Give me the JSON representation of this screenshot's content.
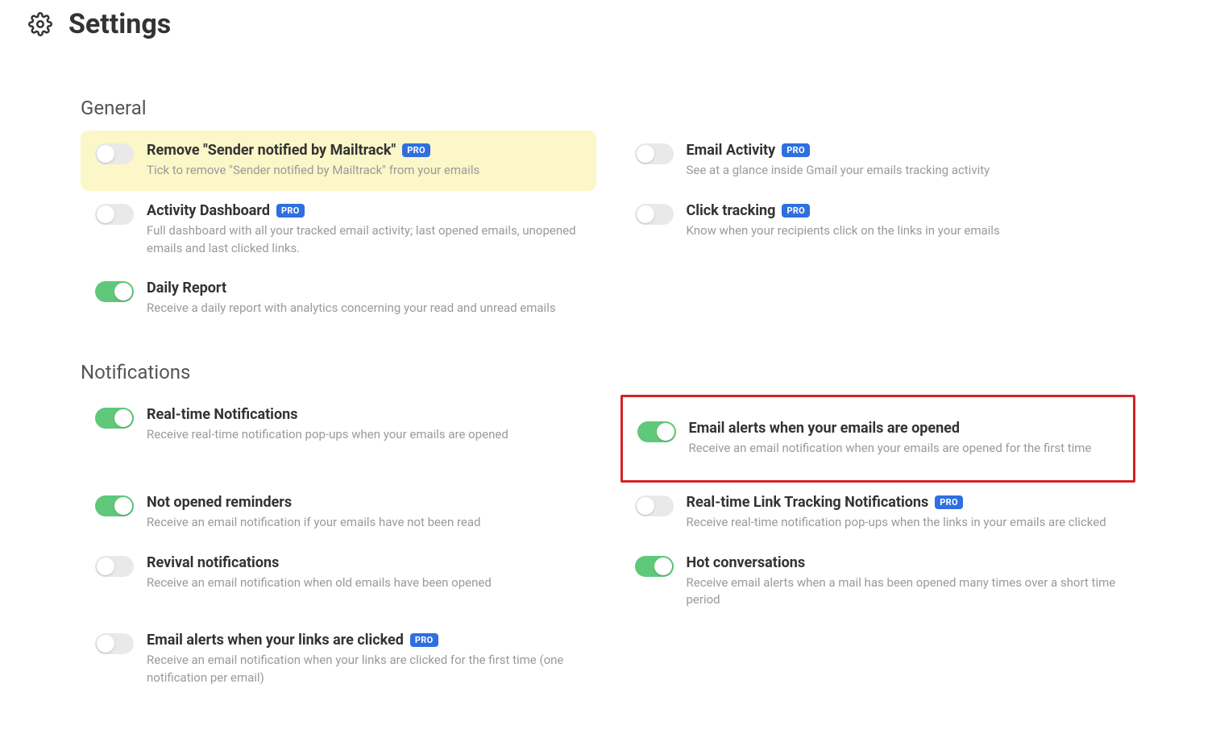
{
  "header": {
    "title": "Settings"
  },
  "badges": {
    "pro": "PRO"
  },
  "sections": {
    "general": {
      "title": "General",
      "items": [
        {
          "label": "Remove \"Sender notified by Mailtrack\"",
          "desc": "Tick to remove \"Sender notified by Mailtrack\" from your emails",
          "pro": true,
          "on": false,
          "highlight": true
        },
        {
          "label": "Email Activity",
          "desc": "See at a glance inside Gmail your emails tracking activity",
          "pro": true,
          "on": false
        },
        {
          "label": "Activity Dashboard",
          "desc": "Full dashboard with all your tracked email activity; last opened emails, unopened emails and last clicked links.",
          "pro": true,
          "on": false
        },
        {
          "label": "Click tracking",
          "desc": "Know when your recipients click on the links in your emails",
          "pro": true,
          "on": false
        },
        {
          "label": "Daily Report",
          "desc": "Receive a daily report with analytics concerning your read and unread emails",
          "pro": false,
          "on": true
        }
      ]
    },
    "notifications": {
      "title": "Notifications",
      "items": [
        {
          "label": "Real-time Notifications",
          "desc": "Receive real-time notification pop-ups when your emails are opened",
          "pro": false,
          "on": true
        },
        {
          "label": "Email alerts when your emails are opened",
          "desc": "Receive an email notification when your emails are opened for the first time",
          "pro": false,
          "on": true,
          "redbox": true
        },
        {
          "label": "Not opened reminders",
          "desc": "Receive an email notification if your emails have not been read",
          "pro": false,
          "on": true
        },
        {
          "label": "Real-time Link Tracking Notifications",
          "desc": "Receive real-time notification pop-ups when the links in your emails are clicked",
          "pro": true,
          "on": false
        },
        {
          "label": "Revival notifications",
          "desc": "Receive an email notification when old emails have been opened",
          "pro": false,
          "on": false
        },
        {
          "label": "Hot conversations",
          "desc": "Receive email alerts when a mail has been opened many times over a short time period",
          "pro": false,
          "on": true
        },
        {
          "label": "Email alerts when your links are clicked",
          "desc": "Receive an email notification when your links are clicked for the first time (one notification per email)",
          "pro": true,
          "on": false
        }
      ]
    }
  }
}
